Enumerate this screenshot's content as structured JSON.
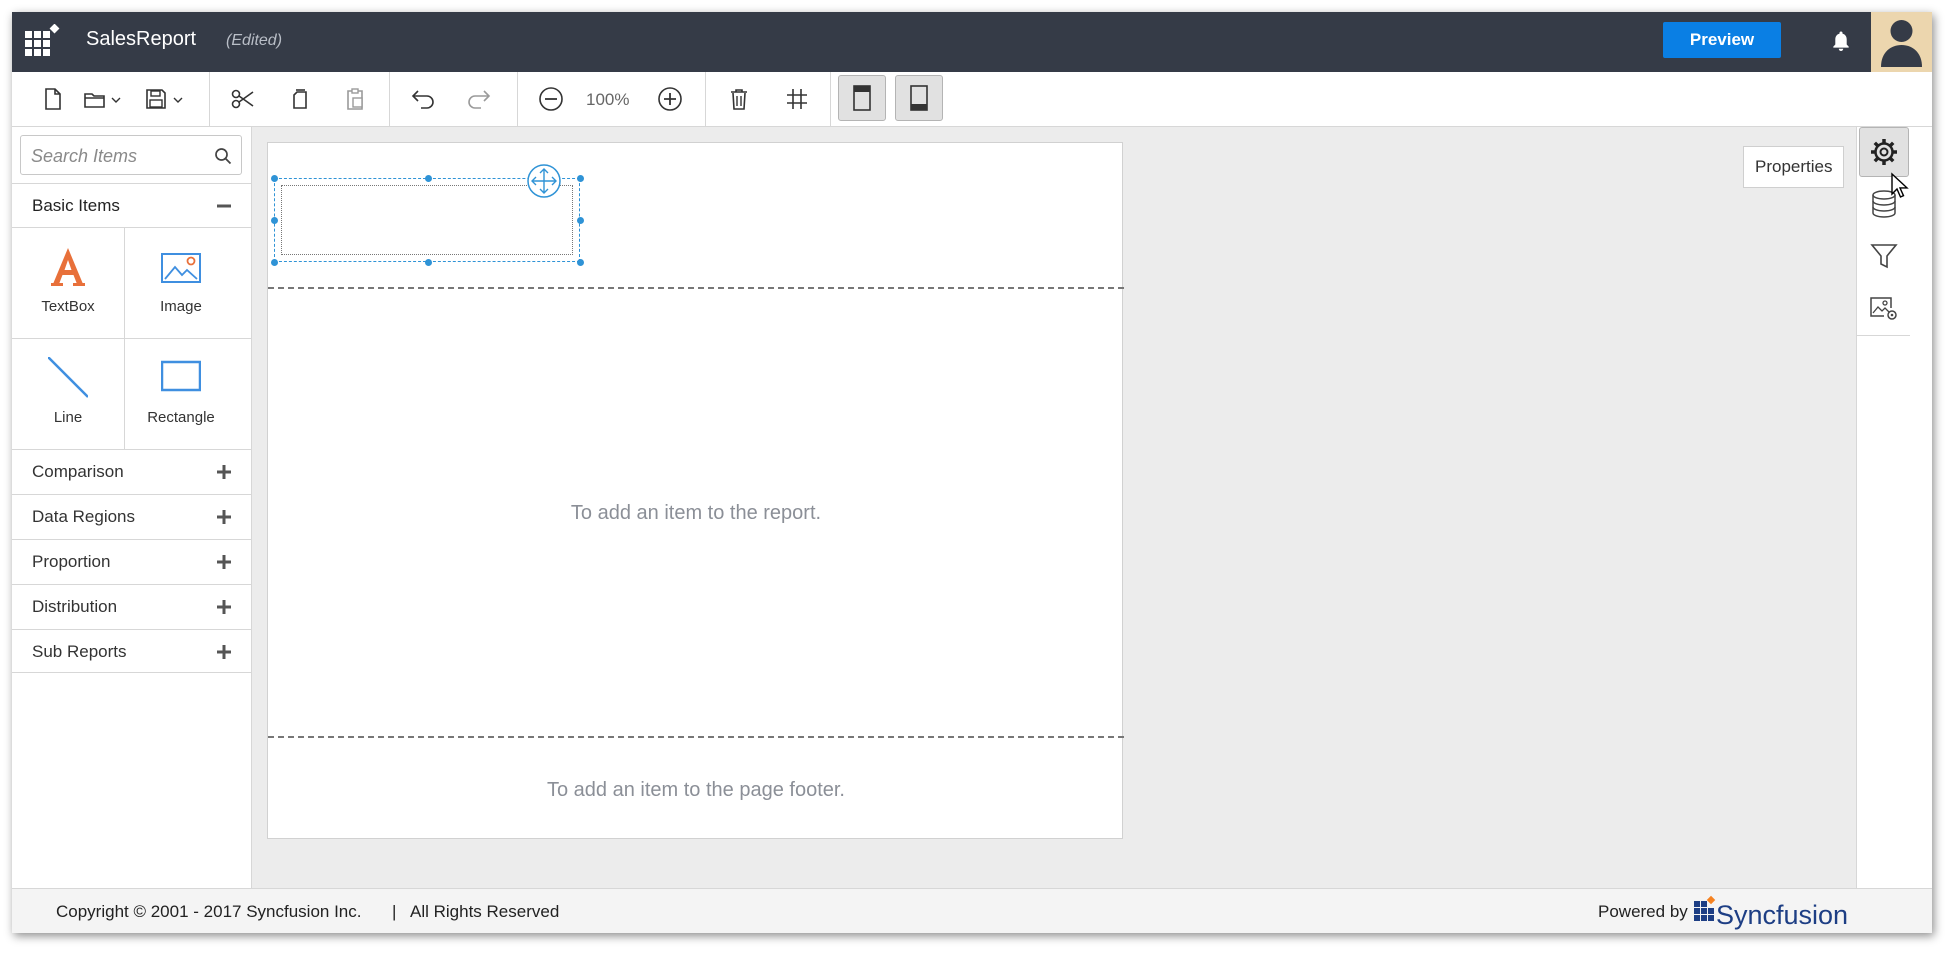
{
  "header": {
    "title": "SalesReport",
    "status": "(Edited)",
    "preview_label": "Preview"
  },
  "toolbar": {
    "zoom_level": "100%"
  },
  "search": {
    "placeholder": "Search Items"
  },
  "left_panel": {
    "basic_items_label": "Basic Items",
    "items": [
      {
        "label": "TextBox",
        "icon": "textbox-icon"
      },
      {
        "label": "Image",
        "icon": "image-icon"
      },
      {
        "label": "Line",
        "icon": "line-icon"
      },
      {
        "label": "Rectangle",
        "icon": "rectangle-icon"
      }
    ],
    "sections": [
      {
        "label": "Comparison"
      },
      {
        "label": "Data Regions"
      },
      {
        "label": "Proportion"
      },
      {
        "label": "Distribution"
      },
      {
        "label": "Sub Reports"
      }
    ]
  },
  "canvas": {
    "body_hint": "To add an item to the report.",
    "footer_hint": "To add an item to the page footer."
  },
  "right_panel": {
    "tooltip": "Properties"
  },
  "footer": {
    "copyright": "Copyright © 2001 - 2017 Syncfusion Inc.",
    "separator": "|",
    "rights": "All Rights Reserved",
    "powered_by": "Powered by",
    "brand": "Syncfusion"
  },
  "colors": {
    "header_bg": "#353b47",
    "accent": "#0a7fe4",
    "textbox_icon": "#e8703a",
    "item_icon_blue": "#3f8fe0"
  }
}
